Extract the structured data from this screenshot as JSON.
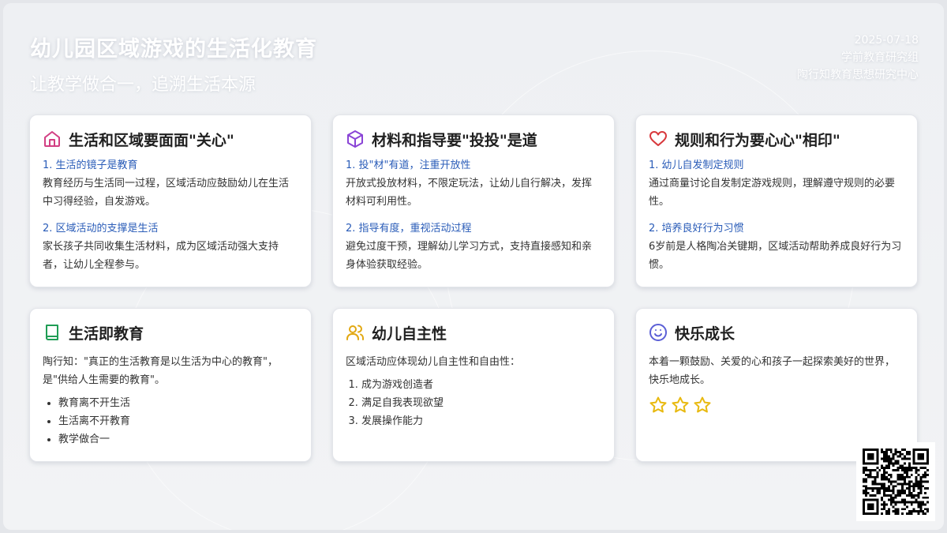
{
  "header": {
    "title": "幼儿园区域游戏的生活化教育",
    "subtitle": "让教学做合一，追溯生活本源",
    "date": "2025-07-18",
    "group": "学前教育研究组",
    "center": "陶行知教育思想研究中心"
  },
  "cards": [
    {
      "icon": "home-icon",
      "title": "生活和区域要面面\"关心\"",
      "sections": [
        {
          "heading": "1. 生活的镜子是教育",
          "text": "教育经历与生活同一过程，区域活动应鼓励幼儿在生活中习得经验，自发游戏。"
        },
        {
          "heading": "2. 区域活动的支撑是生活",
          "text": "家长孩子共同收集生活材料，成为区域活动强大支持者，让幼儿全程参与。"
        }
      ]
    },
    {
      "icon": "cube-icon",
      "title": "材料和指导要\"投投\"是道",
      "sections": [
        {
          "heading": "1. 投\"材\"有道，注重开放性",
          "text": "开放式投放材料，不限定玩法，让幼儿自行解决，发挥材料可利用性。"
        },
        {
          "heading": "2. 指导有度，重视活动过程",
          "text": "避免过度干预，理解幼儿学习方式，支持直接感知和亲身体验获取经验。"
        }
      ]
    },
    {
      "icon": "heart-icon",
      "title": "规则和行为要心心\"相印\"",
      "sections": [
        {
          "heading": "1. 幼儿自发制定规则",
          "text": "通过商量讨论自发制定游戏规则，理解遵守规则的必要性。"
        },
        {
          "heading": "2. 培养良好行为习惯",
          "text": "6岁前是人格陶冶关键期，区域活动帮助养成良好行为习惯。"
        }
      ]
    },
    {
      "icon": "book-icon",
      "title": "生活即教育",
      "text": "陶行知：\"真正的生活教育是以生活为中心的教育\"，是\"供给人生需要的教育\"。",
      "bullets": [
        "教育离不开生活",
        "生活离不开教育",
        "教学做合一"
      ]
    },
    {
      "icon": "users-icon",
      "title": "幼儿自主性",
      "text": "区域活动应体现幼儿自主性和自由性：",
      "numbered": [
        "成为游戏创造者",
        "满足自我表现欲望",
        "发展操作能力"
      ]
    },
    {
      "icon": "smile-icon",
      "title": "快乐成长",
      "text": "本着一颗鼓励、关爱的心和孩子一起探索美好的世界，快乐地成长。",
      "stars": 3
    }
  ],
  "colors": {
    "home_icon": "#d23f83",
    "cube_icon": "#8a44d6",
    "heart_icon": "#d8383c",
    "book_icon": "#1f9d55",
    "users_icon": "#e2a812",
    "smile_icon": "#5b5fd6",
    "star": "#e8b90f",
    "section_heading": "#2a5cb8"
  }
}
